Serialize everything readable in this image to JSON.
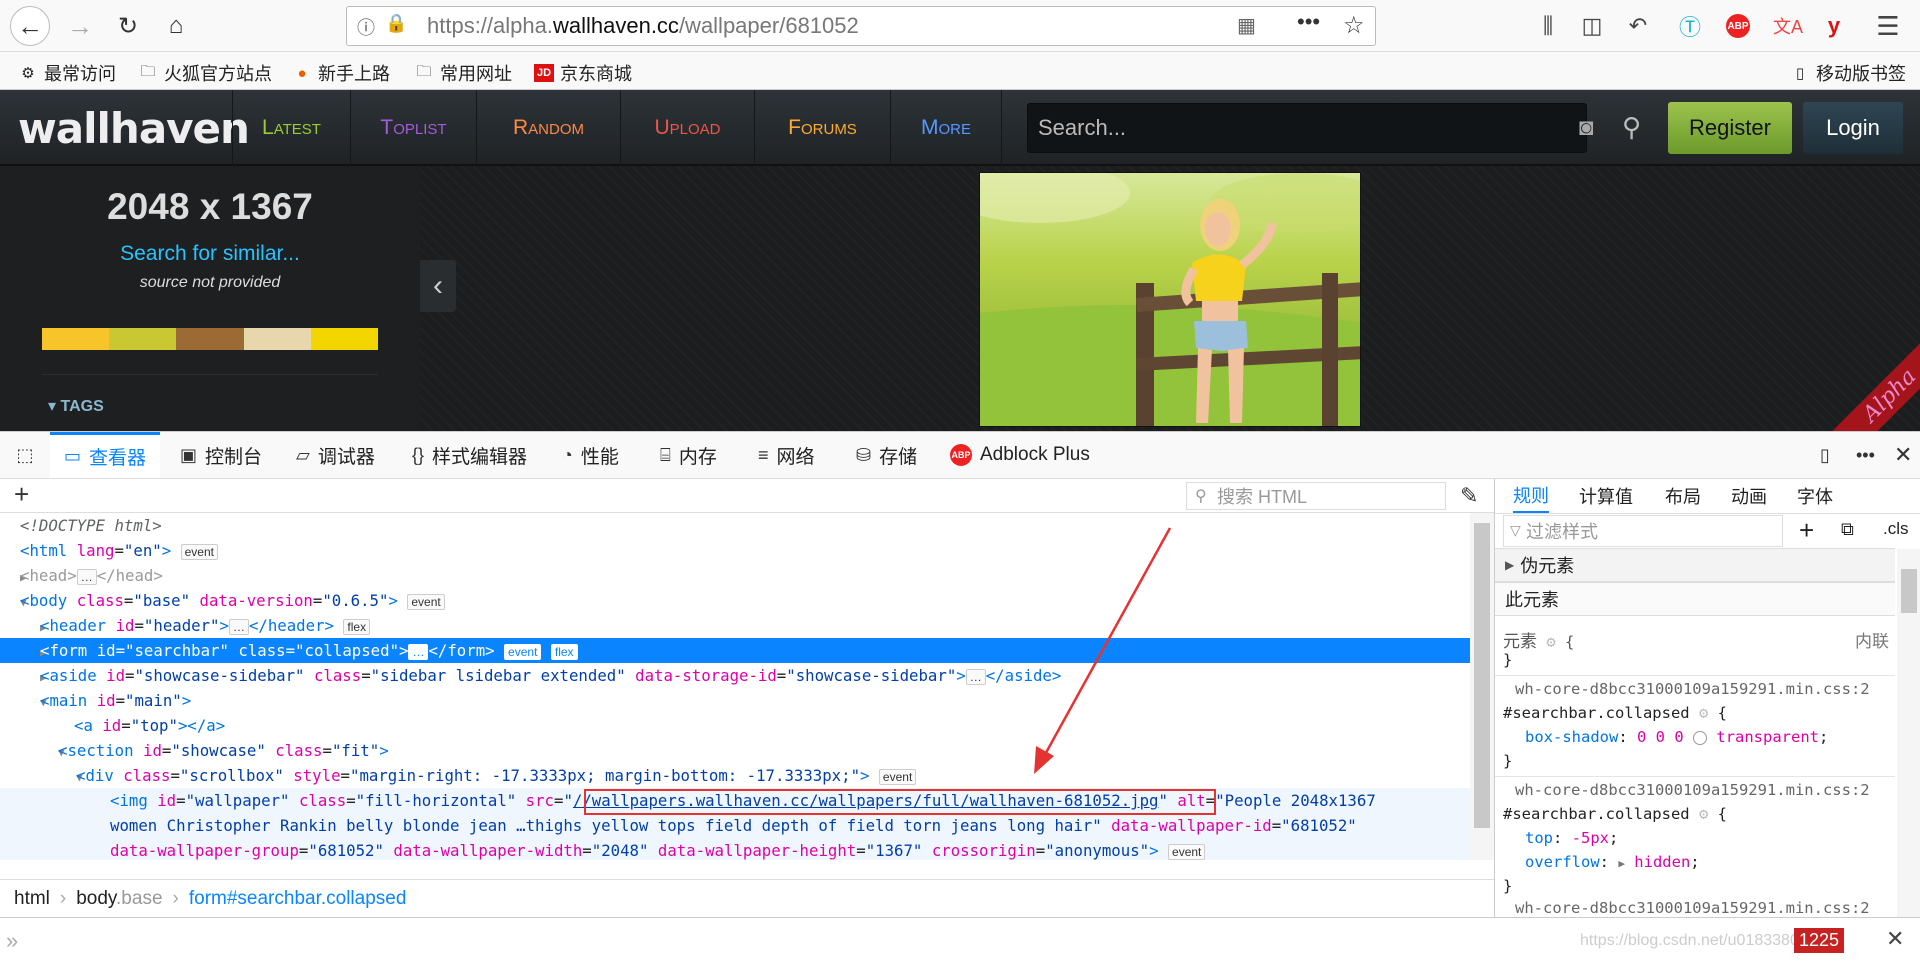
{
  "browser": {
    "url_prefix": "https://alpha.",
    "url_domain": "wallhaven.cc",
    "url_path": "/wallpaper/681052",
    "bookmarks": [
      "最常访问",
      "火狐官方站点",
      "新手上路",
      "常用网址",
      "京东商城"
    ],
    "mobile_bookmarks": "移动版书签"
  },
  "site": {
    "logo": "wallhaven",
    "nav": [
      {
        "label": "Latest",
        "color": "#99cc33"
      },
      {
        "label": "Toplist",
        "color": "#a45cdc"
      },
      {
        "label": "Random",
        "color": "#ff8844"
      },
      {
        "label": "Upload",
        "color": "#ee5544"
      },
      {
        "label": "Forums",
        "color": "#ffaa33"
      },
      {
        "label": "More",
        "color": "#5599ff"
      }
    ],
    "search_placeholder": "Search...",
    "register": "Register",
    "login": "Login"
  },
  "sidebar": {
    "resolution": "2048 x 1367",
    "search_similar": "Search for similar...",
    "source": "source not provided",
    "palette": [
      "#f7c429",
      "#c9c832",
      "#9c6a35",
      "#e8d6ac",
      "#f3d500"
    ],
    "tags_label": "TAGS"
  },
  "ribbon": "Alpha",
  "devtools": {
    "tabs": [
      "查看器",
      "控制台",
      "调试器",
      "样式编辑器",
      "性能",
      "内存",
      "网络",
      "存储",
      "Adblock Plus"
    ],
    "search_html": "搜索 HTML",
    "markup": {
      "l1": "<!DOCTYPE html>",
      "html_tag": "html",
      "html_lang": "en",
      "head": "head",
      "body_class": "base",
      "body_version": "0.6.5",
      "header_id": "header",
      "form_id": "searchbar",
      "form_class": "collapsed",
      "aside_id": "showcase-sidebar",
      "aside_class": "sidebar lsidebar extended",
      "aside_storage": "showcase-sidebar",
      "main_id": "main",
      "a_id": "top",
      "section_id": "showcase",
      "section_class": "fit",
      "div_class": "scrollbox",
      "div_style": "margin-right: -17.3333px; margin-bottom: -17.3333px;",
      "img_id": "wallpaper",
      "img_class": "fill-horizontal",
      "img_src": "//wallpapers.wallhaven.cc/wallpapers/full/wallhaven-681052.jpg",
      "img_alt_1": "People 2048x1367",
      "img_alt_2": "women Christopher Rankin belly blonde jean …thighs yellow tops field depth of field torn jeans long hair",
      "img_wid": "681052",
      "img_group": "681052",
      "img_width": "2048",
      "img_height": "1367",
      "img_cross": "anonymous",
      "badge_event": "event",
      "badge_flex": "flex"
    },
    "breadcrumb": [
      "html",
      "body",
      ".base",
      "form",
      "#searchbar",
      ".collapsed"
    ],
    "right_tabs": [
      "规则",
      "计算值",
      "布局",
      "动画",
      "字体"
    ],
    "filter_placeholder": "过滤样式",
    "cls": ".cls",
    "pseudo": "伪元素",
    "this_element": "此元素",
    "element_label": "元素",
    "inline_label": "内联",
    "css_source": "wh-core-d8bcc31000109a159291.min.css:2",
    "rule1_selector": "#searchbar.collapsed",
    "rule1_prop": "box-shadow",
    "rule1_val_a": "0 0 0",
    "rule1_val_b": "transparent",
    "rule2_selector": "#searchbar.collapsed",
    "rule2_prop1": "top",
    "rule2_val1": "-5px",
    "rule2_prop2": "overflow",
    "rule2_val2": "hidden",
    "error_count": "1225",
    "watermark": "https://blog.csdn.net/u01833809"
  }
}
